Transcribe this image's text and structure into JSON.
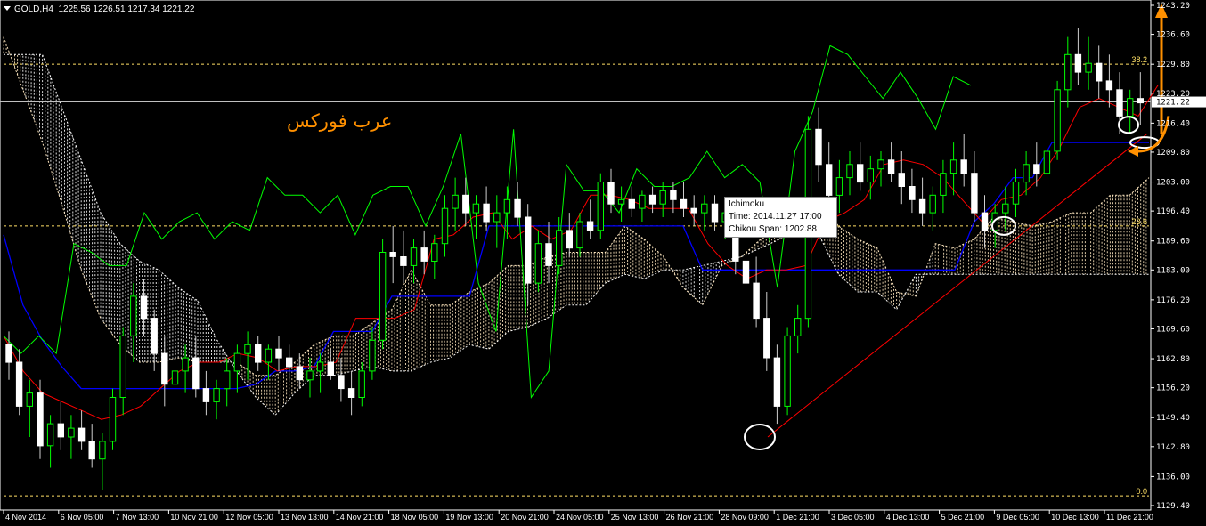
{
  "header": {
    "symbol": "GOLD,H4",
    "ohlc": "1225.56 1226.51 1217.34 1221.22"
  },
  "watermark": "عرب فوركس",
  "tooltip": {
    "line1": "Ichimoku",
    "line2": "Time: 2014.11.27 17:00",
    "line3": "Chikou Span: 1202.88"
  },
  "colors": {
    "bg": "#000000",
    "bull": "#00ff00",
    "bear": "#ffffff",
    "tenkan": "#ff0000",
    "kijun": "#0000ff",
    "chikou": "#00ff00",
    "cloud_up": "#ffe8c0",
    "cloud_dn": "#ffffff",
    "fib": "#ffe066",
    "annotation": "#ff9000"
  },
  "chart_data": {
    "type": "candlestick",
    "symbol": "GOLD",
    "timeframe": "H4",
    "ylim": [
      1129.4,
      1243.2
    ],
    "yticks": [
      1243.2,
      1236.6,
      1229.8,
      1223.2,
      1216.4,
      1209.8,
      1203.0,
      1196.4,
      1189.6,
      1183.0,
      1176.2,
      1169.6,
      1162.8,
      1156.2,
      1149.4,
      1142.8,
      1136.0,
      1129.4
    ],
    "current_price": 1221.22,
    "xticks": [
      "4 Nov 2014",
      "6 Nov 05:00",
      "7 Nov 13:00",
      "10 Nov 21:00",
      "12 Nov 05:00",
      "13 Nov 13:00",
      "14 Nov 21:00",
      "18 Nov 05:00",
      "19 Nov 13:00",
      "20 Nov 21:00",
      "24 Nov 05:00",
      "25 Nov 13:00",
      "26 Nov 21:00",
      "28 Nov 09:00",
      "1 Dec 21:00",
      "3 Dec 05:00",
      "4 Dec 13:00",
      "5 Dec 21:00",
      "9 Dec 05:00",
      "10 Dec 13:00",
      "11 Dec 21:00"
    ],
    "fib_levels": [
      {
        "label": "38.2",
        "price": 1229.8
      },
      {
        "label": "23.6",
        "price": 1193.0
      },
      {
        "label": "0.0",
        "price": 1131.6
      }
    ],
    "tenkan": [
      1168,
      1160,
      1155,
      1153,
      1151,
      1149,
      1150,
      1152,
      1156,
      1160,
      1162,
      1162,
      1164,
      1163,
      1160,
      1161,
      1161,
      1162,
      1172,
      1172,
      1172,
      1174,
      1190,
      1191,
      1195,
      1196,
      1190,
      1193,
      1190,
      1192,
      1200,
      1200,
      1199,
      1197,
      1197,
      1197,
      1189,
      1184,
      1181,
      1183,
      1183,
      1184,
      1194,
      1196,
      1199,
      1207,
      1208,
      1207,
      1204,
      1199,
      1194,
      1199,
      1200,
      1204,
      1211,
      1220,
      1222,
      1220,
      1218,
      1225
    ],
    "kijun": [
      1191,
      1175,
      1167,
      1161,
      1156,
      1156,
      1156,
      1156,
      1156,
      1156,
      1156,
      1156,
      1156,
      1157,
      1160,
      1160,
      1161,
      1169,
      1169,
      1169,
      1177,
      1177,
      1177,
      1177,
      1177,
      1193,
      1193,
      1193,
      1193,
      1193,
      1193,
      1193,
      1193,
      1193,
      1193,
      1193,
      1183,
      1183,
      1183,
      1183,
      1183,
      1183,
      1183,
      1183,
      1183,
      1183,
      1183,
      1183,
      1183,
      1183,
      1194,
      1198,
      1204,
      1204,
      1212,
      1212,
      1212,
      1212,
      1212,
      1212
    ],
    "chikou": [
      1168,
      1164,
      1168,
      1164,
      1189,
      1187,
      1184,
      1184,
      1196,
      1190,
      1194,
      1196,
      1190,
      1194,
      1192,
      1204,
      1200,
      1200,
      1196,
      1200,
      1191,
      1200,
      1202,
      1202,
      1193,
      1202,
      1214,
      1180,
      1169,
      1215,
      1154,
      1160,
      1207,
      1201,
      1201,
      1196,
      1206,
      1202,
      1202,
      1204,
      1210,
      1204,
      1207,
      1203,
      1179,
      1210,
      1219,
      1234,
      1232,
      1227,
      1222,
      1228,
      1222,
      1215,
      1227,
      1225
    ],
    "cloud_a": [
      1236,
      1224,
      1212,
      1198,
      1183,
      1172,
      1166,
      1162,
      1162,
      1163,
      1162,
      1162,
      1162,
      1159,
      1159,
      1162,
      1166,
      1168,
      1168,
      1171,
      1174,
      1183,
      1175,
      1175,
      1178,
      1180,
      1184,
      1184,
      1186,
      1187,
      1187,
      1187,
      1193,
      1190,
      1186,
      1179,
      1175,
      1184,
      1186,
      1190,
      1193,
      1197,
      1199,
      1193,
      1190,
      1188,
      1178,
      1177,
      1189,
      1188,
      1190,
      1195,
      1194,
      1193,
      1194,
      1196,
      1196,
      1200,
      1200,
      1204
    ],
    "cloud_b": [
      1232,
      1232,
      1232,
      1220,
      1208,
      1196,
      1189,
      1185,
      1183,
      1179,
      1176,
      1167,
      1160,
      1154,
      1150,
      1155,
      1159,
      1159,
      1160,
      1161,
      1160,
      1160,
      1162,
      1163,
      1166,
      1165,
      1169,
      1170,
      1172,
      1175,
      1175,
      1180,
      1182,
      1181,
      1183,
      1183,
      1184,
      1185,
      1186,
      1188,
      1190,
      1192,
      1191,
      1182,
      1178,
      1178,
      1174,
      1182,
      1182,
      1182,
      1182,
      1182,
      1182,
      1182,
      1182,
      1182,
      1182,
      1182,
      1182,
      1182
    ],
    "candles": [
      [
        1166,
        1169,
        1158,
        1162
      ],
      [
        1162,
        1165,
        1150,
        1152
      ],
      [
        1152,
        1158,
        1145,
        1155
      ],
      [
        1155,
        1158,
        1140,
        1143
      ],
      [
        1143,
        1150,
        1138,
        1148
      ],
      [
        1148,
        1153,
        1142,
        1145
      ],
      [
        1145,
        1150,
        1140,
        1147
      ],
      [
        1147,
        1151,
        1142,
        1144
      ],
      [
        1144,
        1148,
        1138,
        1140
      ],
      [
        1140,
        1146,
        1133,
        1144
      ],
      [
        1144,
        1156,
        1142,
        1154
      ],
      [
        1154,
        1170,
        1150,
        1168
      ],
      [
        1168,
        1180,
        1162,
        1177
      ],
      [
        1177,
        1181,
        1168,
        1172
      ],
      [
        1172,
        1174,
        1160,
        1164
      ],
      [
        1164,
        1168,
        1152,
        1157
      ],
      [
        1157,
        1163,
        1150,
        1160
      ],
      [
        1160,
        1166,
        1155,
        1163
      ],
      [
        1163,
        1168,
        1154,
        1156
      ],
      [
        1156,
        1160,
        1150,
        1153
      ],
      [
        1153,
        1158,
        1149,
        1156
      ],
      [
        1156,
        1163,
        1152,
        1160
      ],
      [
        1160,
        1166,
        1155,
        1164
      ],
      [
        1164,
        1169,
        1158,
        1166
      ],
      [
        1166,
        1168,
        1160,
        1162
      ],
      [
        1162,
        1166,
        1158,
        1165
      ],
      [
        1165,
        1168,
        1160,
        1163
      ],
      [
        1163,
        1166,
        1158,
        1161
      ],
      [
        1161,
        1164,
        1156,
        1158
      ],
      [
        1158,
        1163,
        1154,
        1160
      ],
      [
        1160,
        1164,
        1155,
        1162
      ],
      [
        1162,
        1165,
        1158,
        1159
      ],
      [
        1159,
        1163,
        1153,
        1156
      ],
      [
        1156,
        1160,
        1150,
        1154
      ],
      [
        1154,
        1162,
        1152,
        1160
      ],
      [
        1160,
        1170,
        1158,
        1167
      ],
      [
        1167,
        1190,
        1165,
        1187
      ],
      [
        1187,
        1193,
        1180,
        1186
      ],
      [
        1186,
        1192,
        1180,
        1184
      ],
      [
        1184,
        1190,
        1180,
        1188
      ],
      [
        1188,
        1192,
        1182,
        1185
      ],
      [
        1185,
        1191,
        1181,
        1189
      ],
      [
        1189,
        1200,
        1186,
        1197
      ],
      [
        1197,
        1204,
        1192,
        1200
      ],
      [
        1200,
        1204,
        1193,
        1196
      ],
      [
        1196,
        1200,
        1190,
        1198
      ],
      [
        1198,
        1202,
        1192,
        1194
      ],
      [
        1194,
        1200,
        1188,
        1196
      ],
      [
        1196,
        1202,
        1190,
        1199
      ],
      [
        1199,
        1203,
        1193,
        1195
      ],
      [
        1195,
        1198,
        1175,
        1180
      ],
      [
        1180,
        1192,
        1178,
        1189
      ],
      [
        1189,
        1194,
        1180,
        1184
      ],
      [
        1184,
        1195,
        1182,
        1192
      ],
      [
        1192,
        1196,
        1186,
        1188
      ],
      [
        1188,
        1196,
        1186,
        1194
      ],
      [
        1194,
        1199,
        1190,
        1192
      ],
      [
        1192,
        1205,
        1190,
        1203
      ],
      [
        1203,
        1206,
        1196,
        1198
      ],
      [
        1198,
        1202,
        1194,
        1199
      ],
      [
        1199,
        1202,
        1195,
        1197
      ],
      [
        1197,
        1201,
        1194,
        1200
      ],
      [
        1200,
        1202,
        1196,
        1198
      ],
      [
        1198,
        1203,
        1195,
        1201
      ],
      [
        1201,
        1203,
        1196,
        1199
      ],
      [
        1199,
        1203,
        1195,
        1197
      ],
      [
        1197,
        1200,
        1193,
        1196
      ],
      [
        1196,
        1200,
        1192,
        1198
      ],
      [
        1198,
        1200,
        1192,
        1194
      ],
      [
        1194,
        1198,
        1190,
        1196
      ],
      [
        1196,
        1198,
        1182,
        1185
      ],
      [
        1185,
        1190,
        1178,
        1180
      ],
      [
        1180,
        1186,
        1170,
        1172
      ],
      [
        1172,
        1178,
        1160,
        1163
      ],
      [
        1163,
        1166,
        1148,
        1152
      ],
      [
        1152,
        1170,
        1150,
        1168
      ],
      [
        1168,
        1175,
        1164,
        1172
      ],
      [
        1172,
        1218,
        1170,
        1215
      ],
      [
        1215,
        1220,
        1203,
        1207
      ],
      [
        1207,
        1212,
        1198,
        1200
      ],
      [
        1200,
        1208,
        1196,
        1204
      ],
      [
        1204,
        1210,
        1200,
        1207
      ],
      [
        1207,
        1212,
        1201,
        1203
      ],
      [
        1203,
        1209,
        1199,
        1206
      ],
      [
        1206,
        1210,
        1202,
        1208
      ],
      [
        1208,
        1212,
        1203,
        1205
      ],
      [
        1205,
        1210,
        1198,
        1202
      ],
      [
        1202,
        1206,
        1196,
        1199
      ],
      [
        1199,
        1204,
        1193,
        1196
      ],
      [
        1196,
        1202,
        1192,
        1200
      ],
      [
        1200,
        1208,
        1196,
        1205
      ],
      [
        1205,
        1212,
        1200,
        1208
      ],
      [
        1208,
        1214,
        1202,
        1205
      ],
      [
        1205,
        1210,
        1194,
        1196
      ],
      [
        1196,
        1200,
        1188,
        1192
      ],
      [
        1192,
        1198,
        1188,
        1196
      ],
      [
        1196,
        1202,
        1192,
        1198
      ],
      [
        1198,
        1206,
        1195,
        1203
      ],
      [
        1203,
        1210,
        1200,
        1207
      ],
      [
        1207,
        1212,
        1202,
        1205
      ],
      [
        1205,
        1212,
        1202,
        1210
      ],
      [
        1210,
        1226,
        1208,
        1224
      ],
      [
        1224,
        1236,
        1220,
        1232
      ],
      [
        1232,
        1238,
        1225,
        1228
      ],
      [
        1228,
        1236,
        1224,
        1230
      ],
      [
        1230,
        1234,
        1222,
        1226
      ],
      [
        1226,
        1232,
        1220,
        1224
      ],
      [
        1224,
        1228,
        1214,
        1218
      ],
      [
        1218,
        1224,
        1214,
        1222
      ],
      [
        1222,
        1228,
        1216,
        1221
      ]
    ],
    "annotations": {
      "diagonal_support": {
        "from_price": 1145.0,
        "to_price": 1214.0
      },
      "circles_at_price": [
        1145.0,
        1193.0,
        1216.0,
        1212.0
      ],
      "arrow_up_target": 1243.2
    }
  }
}
